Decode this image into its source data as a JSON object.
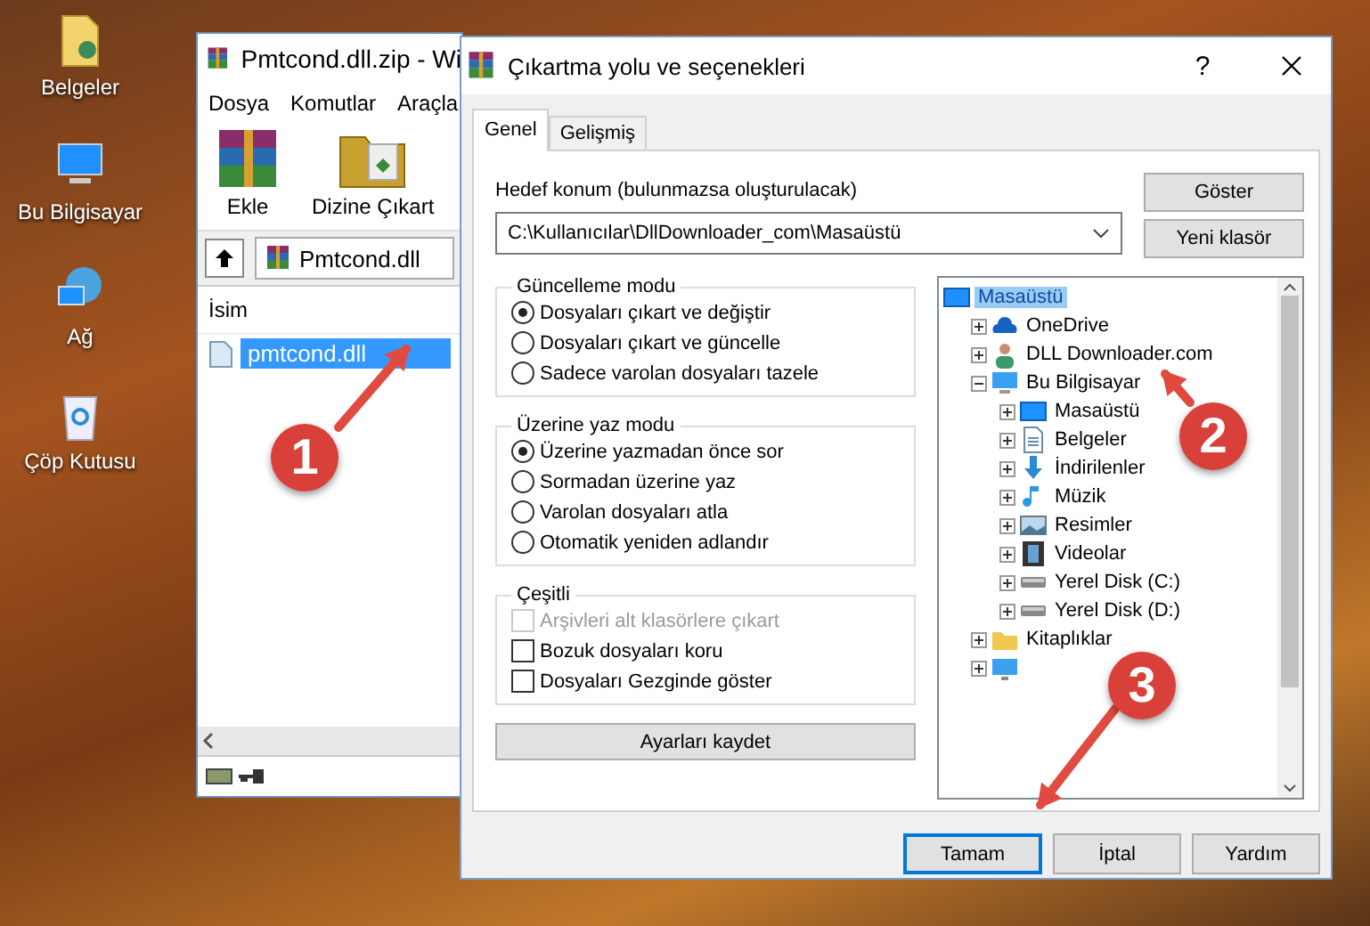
{
  "desktop_icons": [
    {
      "label": "Belgeler",
      "kind": "documents"
    },
    {
      "label": "Bu Bilgisayar",
      "kind": "computer"
    },
    {
      "label": "Ağ",
      "kind": "network"
    },
    {
      "label": "Çöp Kutusu",
      "kind": "recycle"
    }
  ],
  "archiver": {
    "title": "Pmtcond.dll.zip - Wi",
    "menu": [
      "Dosya",
      "Komutlar",
      "Araçla"
    ],
    "toolbar": [
      {
        "label": "Ekle",
        "kind": "add"
      },
      {
        "label": "Dizine Çıkart",
        "kind": "extract"
      }
    ],
    "address": "Pmtcond.dll",
    "column": "İsim",
    "files": [
      {
        "name": "pmtcond.dll",
        "selected": true
      }
    ]
  },
  "dialog": {
    "title": "Çıkartma yolu ve seçenekleri",
    "help": "?",
    "tabs": [
      {
        "label": "Genel",
        "selected": true
      },
      {
        "label": "Gelişmiş",
        "selected": false
      }
    ],
    "destination_label": "Hedef konum (bulunmazsa oluşturulacak)",
    "destination": "C:\\Kullanıcılar\\DllDownloader_com\\Masaüstü",
    "side_buttons": [
      "Göster",
      "Yeni klasör"
    ],
    "groups": [
      {
        "title": "Güncelleme modu",
        "kind": "radio",
        "options": [
          {
            "label": "Dosyaları çıkart ve değiştir",
            "selected": true
          },
          {
            "label": "Dosyaları çıkart ve güncelle",
            "selected": false
          },
          {
            "label": "Sadece varolan dosyaları tazele",
            "selected": false
          }
        ]
      },
      {
        "title": "Üzerine yaz modu",
        "kind": "radio",
        "options": [
          {
            "label": "Üzerine yazmadan önce sor",
            "selected": true
          },
          {
            "label": "Sormadan üzerine yaz",
            "selected": false
          },
          {
            "label": "Varolan dosyaları atla",
            "selected": false
          },
          {
            "label": "Otomatik yeniden adlandır",
            "selected": false
          }
        ]
      },
      {
        "title": "Çeşitli",
        "kind": "checkbox",
        "options": [
          {
            "label": "Arşivleri alt klasörlere çıkart",
            "checked": false,
            "disabled": true
          },
          {
            "label": "Bozuk dosyaları koru",
            "checked": false,
            "disabled": false
          },
          {
            "label": "Dosyaları Gezginde göster",
            "checked": false,
            "disabled": false
          }
        ]
      }
    ],
    "save_button": "Ayarları kaydet",
    "tree": [
      {
        "label": "Masaüstü",
        "kind": "desktop",
        "selected": true,
        "children": [
          {
            "label": "OneDrive",
            "kind": "cloud",
            "selected": false,
            "expanded": false
          },
          {
            "label": "DLL Downloader.com",
            "kind": "user",
            "selected": false,
            "expanded": false
          },
          {
            "label": "Bu Bilgisayar",
            "kind": "computer",
            "selected": false,
            "expanded": true,
            "children": [
              {
                "label": "Masaüstü",
                "kind": "desktop",
                "selected": false,
                "expanded": false
              },
              {
                "label": "Belgeler",
                "kind": "documents",
                "selected": false,
                "expanded": false
              },
              {
                "label": "İndirilenler",
                "kind": "downloads",
                "selected": false,
                "expanded": false
              },
              {
                "label": "Müzik",
                "kind": "music",
                "selected": false,
                "expanded": false
              },
              {
                "label": "Resimler",
                "kind": "pictures",
                "selected": false,
                "expanded": false
              },
              {
                "label": "Videolar",
                "kind": "videos",
                "selected": false,
                "expanded": false
              },
              {
                "label": "Yerel Disk (C:)",
                "kind": "disk",
                "selected": false,
                "expanded": false
              },
              {
                "label": "Yerel Disk (D:)",
                "kind": "disk",
                "selected": false,
                "expanded": false
              }
            ]
          },
          {
            "label": "Kitaplıklar",
            "kind": "library",
            "selected": false,
            "expanded": false
          },
          {
            "kind": "network",
            "selected": false,
            "expanded": false
          }
        ]
      }
    ],
    "buttons": [
      {
        "label": "Tamam",
        "default": true
      },
      {
        "label": "İptal",
        "default": false
      },
      {
        "label": "Yardım",
        "default": false
      }
    ]
  },
  "callouts": [
    "1",
    "2",
    "3"
  ]
}
